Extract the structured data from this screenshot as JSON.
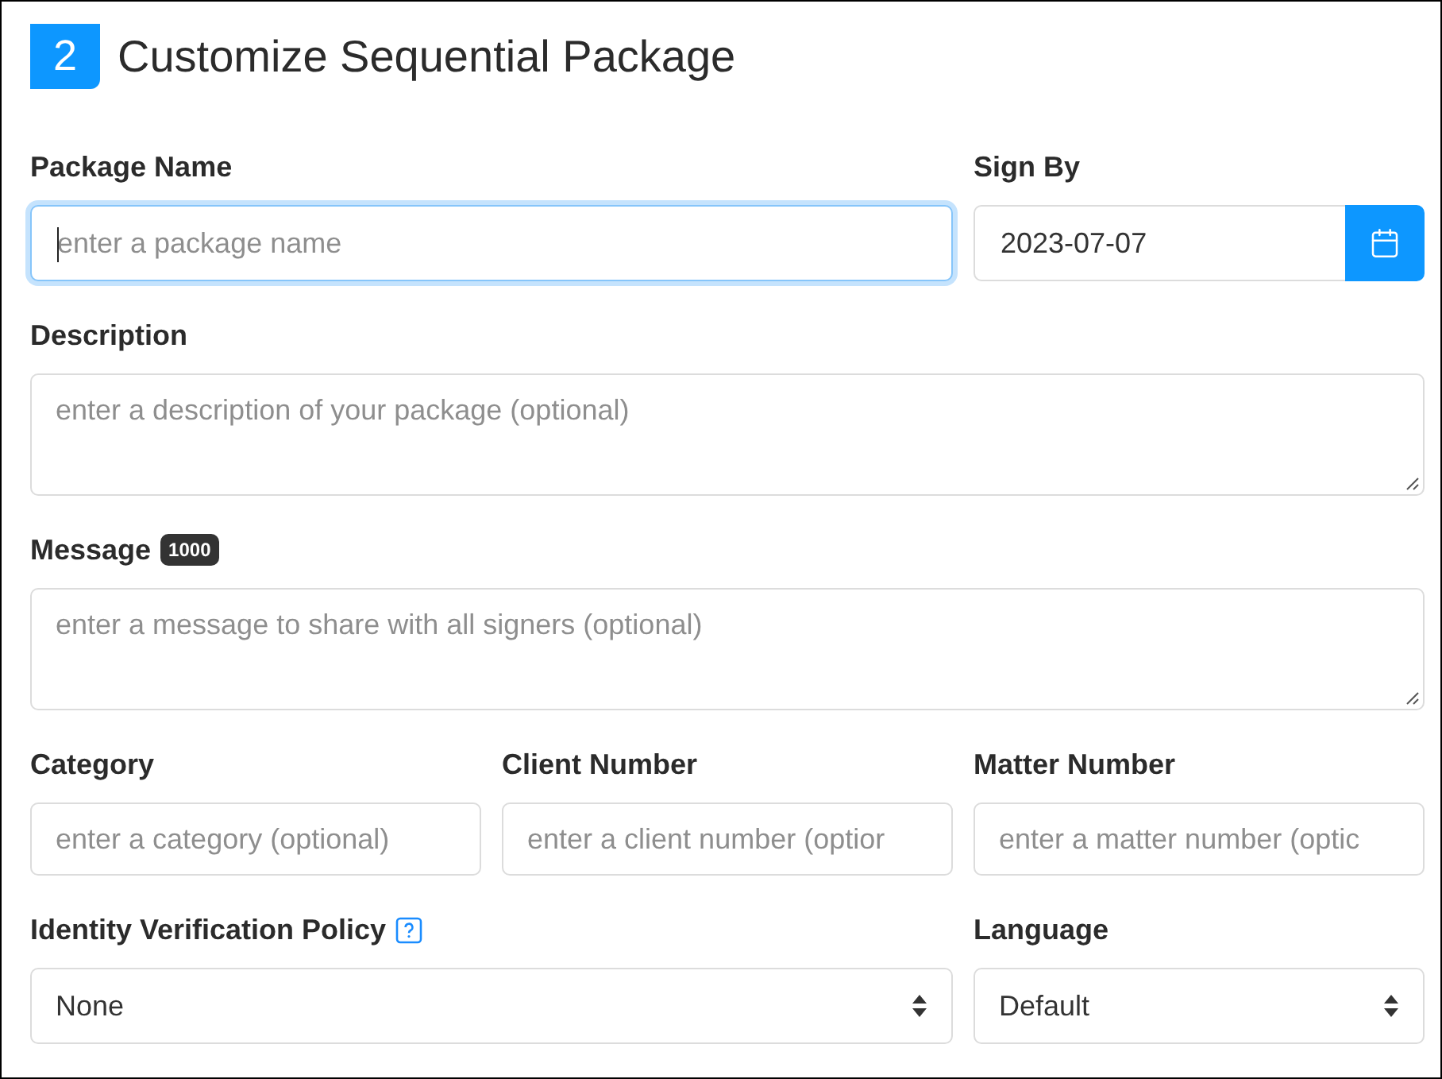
{
  "header": {
    "step": "2",
    "title": "Customize Sequential Package"
  },
  "rows": [
    [
      {
        "kind": "text",
        "label": "Package Name",
        "placeholder": "enter a package name",
        "focused": true
      },
      {
        "kind": "date",
        "label": "Sign By",
        "value": "2023-07-07"
      }
    ],
    [
      {
        "kind": "textarea",
        "label": "Description",
        "placeholder": "enter a description of your package (optional)"
      }
    ],
    [
      {
        "kind": "textarea",
        "label": "Message",
        "badge": "1000",
        "placeholder": "enter a message to share with all signers (optional)"
      }
    ],
    [
      {
        "kind": "text",
        "label": "Category",
        "placeholder": "enter a category (optional)",
        "focused": false
      },
      {
        "kind": "text",
        "label": "Client Number",
        "placeholder": "enter a client number (optior",
        "focused": false
      },
      {
        "kind": "text",
        "label": "Matter Number",
        "placeholder": "enter a matter number (optic",
        "focused": false
      }
    ],
    [
      {
        "kind": "select",
        "label": "Identity Verification Policy",
        "help": true,
        "value": "None"
      },
      {
        "kind": "select",
        "label": "Language",
        "value": "Default"
      }
    ]
  ]
}
